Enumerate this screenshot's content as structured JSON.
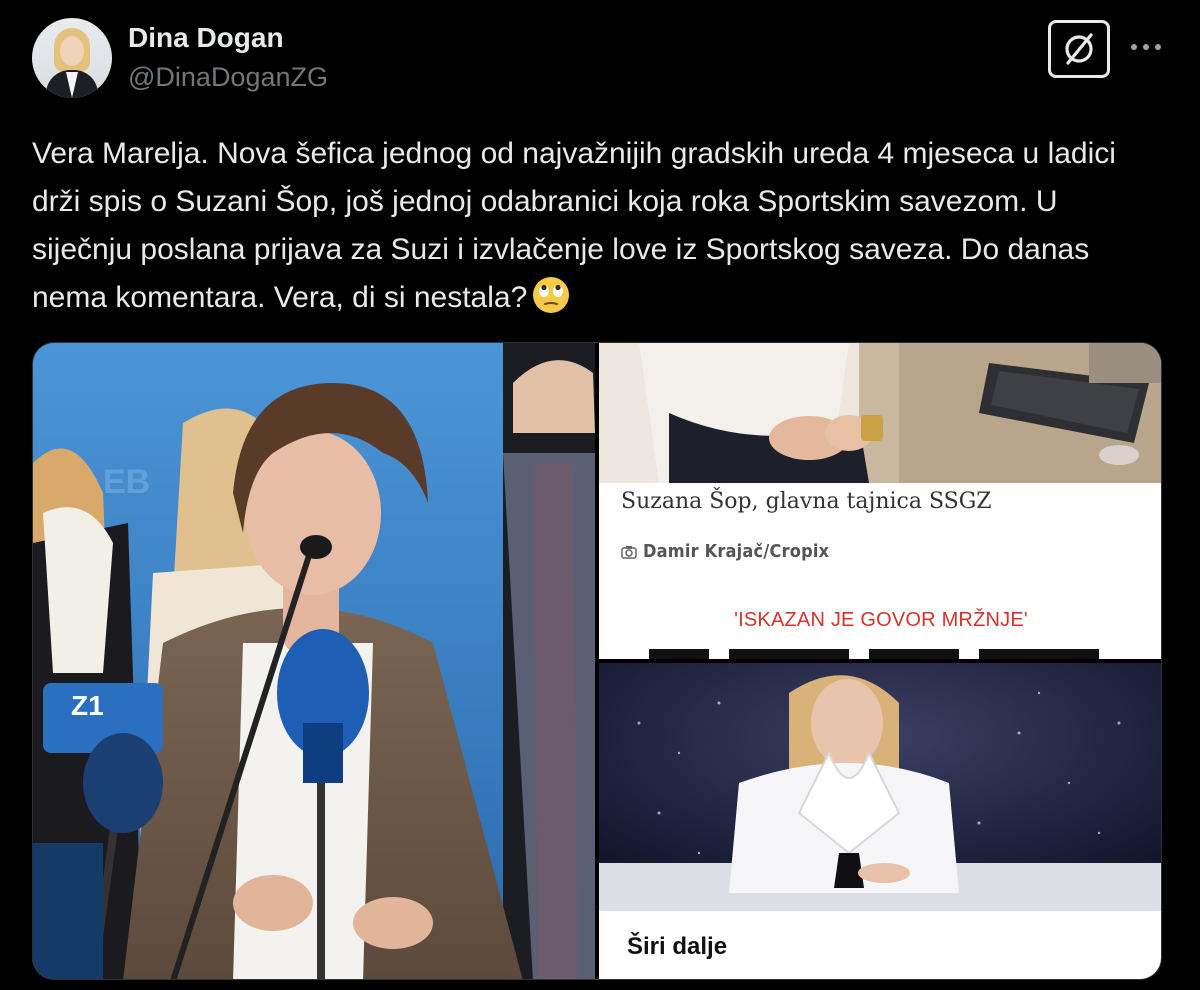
{
  "author": {
    "name": "Dina Dogan",
    "handle": "@DinaDoganZG"
  },
  "actions": {
    "grok": "grok-icon",
    "more": "more-icon"
  },
  "tweet": {
    "text": "Vera Marelja. Nova šefica jednog od najvažnijih gradskih ureda 4 mjeseca u ladici drži spis o Suzani Šop, još jednoj odabranici koja roka Sportskim savezom. U siječnju poslana prijava za Suzi i izvlačenje love iz Sportskog saveza. Do danas nema komentara. Vera, di si nestala?",
    "emoji": "face-with-rolling-eyes"
  },
  "media": {
    "photo_main": {
      "watermark_z1": "Z1",
      "sign_text": "ZAGREB"
    },
    "photo_top": {
      "caption": "Suzana Šop, glavna tajnica SSGZ",
      "credit": "Damir Krajač/Cropix",
      "headline": "'ISKAZAN JE GOVOR MRŽNJE'"
    },
    "photo_bottom": {
      "label": "Širi dalje"
    }
  },
  "colors": {
    "background": "#000000",
    "text": "#e7e9ea",
    "muted": "#71767b",
    "headline_red": "#d4332a"
  }
}
